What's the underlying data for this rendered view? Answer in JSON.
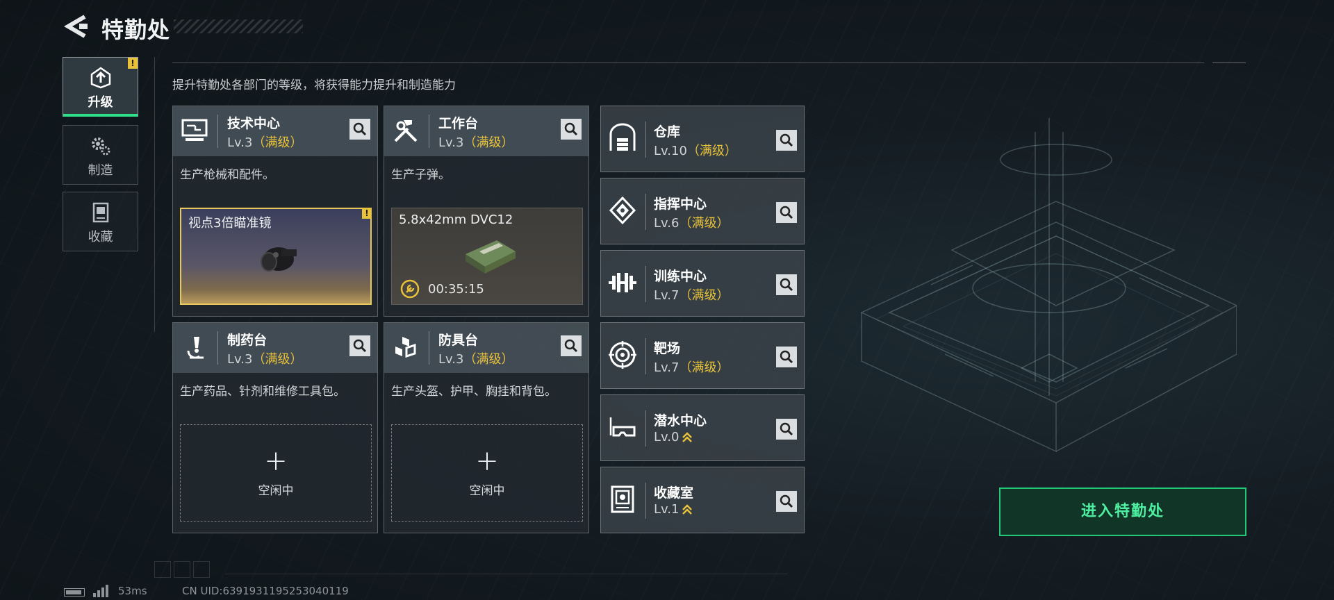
{
  "header": {
    "title": "特勤处"
  },
  "subtitle": "提升特勤处各部门的等级，将获得能力提升和制造能力",
  "nav": [
    {
      "label": "升级",
      "active": true,
      "badge": "!"
    },
    {
      "label": "制造",
      "active": false
    },
    {
      "label": "收藏",
      "active": false
    }
  ],
  "cards": [
    {
      "name": "技术中心",
      "level": "Lv.3",
      "status": "（满级）",
      "desc": "生产枪械和配件。",
      "production": {
        "item": "视点3倍瞄准镜",
        "badge": "!"
      }
    },
    {
      "name": "工作台",
      "level": "Lv.3",
      "status": "（满级）",
      "desc": "生产子弹。",
      "production": {
        "item": "5.8x42mm DVC12",
        "timer": "00:35:15"
      }
    },
    {
      "name": "制药台",
      "level": "Lv.3",
      "status": "（满级）",
      "desc": "生产药品、针剂和维修工具包。",
      "idle_label": "空闲中"
    },
    {
      "name": "防具台",
      "level": "Lv.3",
      "status": "（满级）",
      "desc": "生产头盔、护甲、胸挂和背包。",
      "idle_label": "空闲中"
    }
  ],
  "facilities": [
    {
      "name": "仓库",
      "level": "Lv.10",
      "status": "（满级）"
    },
    {
      "name": "指挥中心",
      "level": "Lv.6",
      "status": "（满级）"
    },
    {
      "name": "训练中心",
      "level": "Lv.7",
      "status": "（满级）"
    },
    {
      "name": "靶场",
      "level": "Lv.7",
      "status": "（满级）"
    },
    {
      "name": "潜水中心",
      "level": "Lv.0",
      "status": "",
      "upgradable": true
    },
    {
      "name": "收藏室",
      "level": "Lv.1",
      "status": "",
      "upgradable": true
    }
  ],
  "enter_button": "进入特勤处",
  "footer": {
    "ping": "53ms",
    "uid": "CN UID:6391931195253040119"
  },
  "colors": {
    "accent_green": "#2fe08a",
    "max_gold": "#e8c23a",
    "enter_text": "#4ef0a2"
  }
}
